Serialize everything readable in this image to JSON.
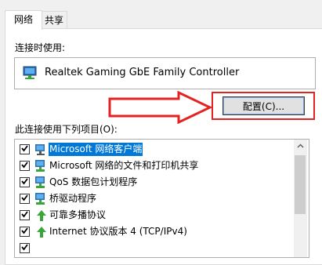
{
  "tabs": [
    {
      "label": "网络",
      "active": true
    },
    {
      "label": "共享",
      "active": false
    }
  ],
  "connect_using_label": "连接时使用:",
  "adapter": {
    "name": "Realtek Gaming GbE Family Controller",
    "icon": "network-adapter-icon"
  },
  "configure_button": "配置(C)...",
  "items_label": "此连接使用下列项目(O):",
  "items": [
    {
      "label": "Microsoft 网络客户端",
      "checked": true,
      "selected": true,
      "icon": "network-client-icon"
    },
    {
      "label": "Microsoft 网络的文件和打印机共享",
      "checked": true,
      "selected": false,
      "icon": "network-service-icon"
    },
    {
      "label": "QoS 数据包计划程序",
      "checked": true,
      "selected": false,
      "icon": "network-service-icon"
    },
    {
      "label": "桥驱动程序",
      "checked": true,
      "selected": false,
      "icon": "network-service-icon"
    },
    {
      "label": "可靠多播协议",
      "checked": true,
      "selected": false,
      "icon": "protocol-icon"
    },
    {
      "label": "Internet 协议版本 4 (TCP/IPv4)",
      "checked": true,
      "selected": false,
      "icon": "protocol-icon"
    }
  ],
  "colors": {
    "selection": "#0078d7",
    "annotation_red": "#e52222",
    "protocol_green": "#3aa63a"
  }
}
